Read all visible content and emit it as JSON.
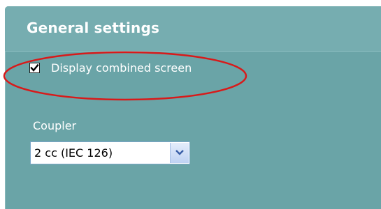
{
  "panel": {
    "title": "General settings",
    "display_combined_screen": {
      "label": "Display combined screen",
      "checked": true
    },
    "coupler": {
      "label": "Coupler",
      "selected": "2 cc (IEC 126)"
    }
  },
  "colors": {
    "panel_bg": "#6aa4a7",
    "header_bg": "#76adb0",
    "highlight": "#d81a1a"
  },
  "icons": {
    "checkbox": "check-icon",
    "dropdown": "chevron-down-icon"
  }
}
